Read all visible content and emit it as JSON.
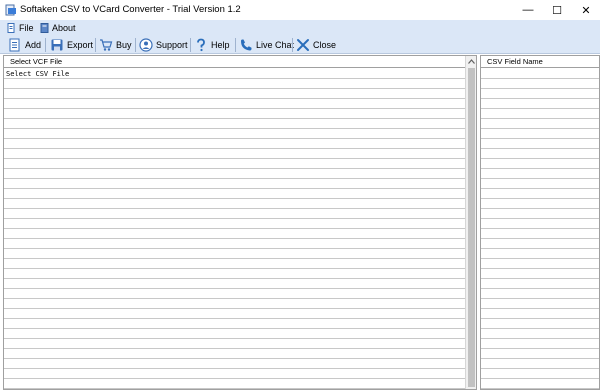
{
  "window": {
    "title": "Softaken CSV to VCard Converter - Trial Version 1.2",
    "minimize_glyph": "—",
    "maximize_glyph": "☐",
    "close_glyph": "✕"
  },
  "menu": {
    "items": [
      {
        "label": "File",
        "icon": "file-icon"
      },
      {
        "label": "About",
        "icon": "about-icon"
      }
    ]
  },
  "toolbar": {
    "buttons": [
      {
        "label": "Add",
        "icon": "add-icon"
      },
      {
        "label": "Export",
        "icon": "export-icon"
      },
      {
        "label": "Buy",
        "icon": "cart-icon"
      },
      {
        "label": "Support",
        "icon": "support-icon"
      },
      {
        "label": "Help",
        "icon": "help-icon"
      },
      {
        "label": "Live Chat",
        "icon": "phone-icon"
      },
      {
        "label": "Close",
        "icon": "close-x-icon"
      }
    ]
  },
  "left_panel": {
    "header": "Select VCF File",
    "rows": [
      "Select CSV File"
    ]
  },
  "right_panel": {
    "header": "CSV Field Name"
  },
  "colors": {
    "menu_bg": "#dbe7f7",
    "grid_line": "#c8c8c8",
    "accent_blue": "#2a6ebb"
  }
}
